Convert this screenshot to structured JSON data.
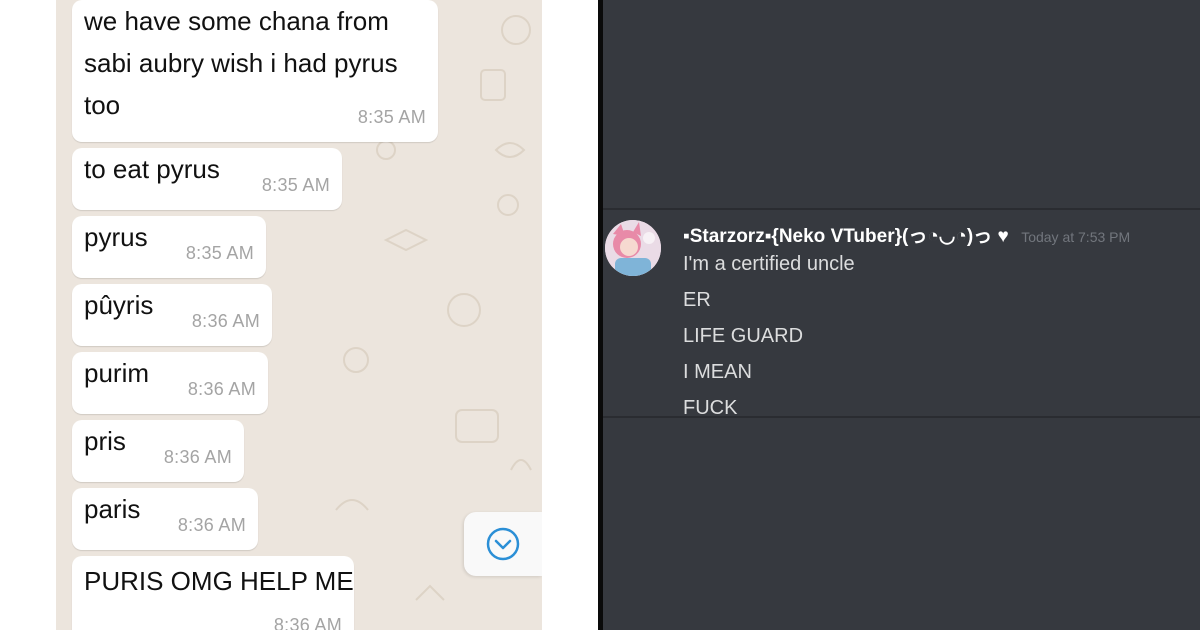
{
  "whatsapp": {
    "messages": [
      {
        "lines": [
          "we have some chana from",
          "sabi aubry wish i had pyrus",
          "too"
        ],
        "time": "8:35 AM"
      },
      {
        "lines": [
          "to eat pyrus"
        ],
        "time": "8:35 AM"
      },
      {
        "lines": [
          "pyrus"
        ],
        "time": "8:35 AM"
      },
      {
        "lines": [
          "pûyris"
        ],
        "time": "8:36 AM"
      },
      {
        "lines": [
          "purim"
        ],
        "time": "8:36 AM"
      },
      {
        "lines": [
          "pris"
        ],
        "time": "8:36 AM"
      },
      {
        "lines": [
          "paris"
        ],
        "time": "8:36 AM"
      },
      {
        "lines": [
          "PURIS OMG HELP ME"
        ],
        "time": "8:36 AM"
      }
    ],
    "scroll_button_icon": "chevron-down-circle-icon",
    "colors": {
      "background": "#ece5dd",
      "bubble": "#ffffff",
      "accent": "#2b8fd6"
    }
  },
  "discord": {
    "avatar_icon": "anime-avatar",
    "username": "▪Starzorz▪{Neko VTuber}(っ◔◡◔)っ ♥",
    "timestamp": "Today at 7:53 PM",
    "messages": [
      "I'm a certified uncle",
      "ER",
      "LIFE GUARD",
      "I MEAN",
      "FUCK"
    ],
    "colors": {
      "background": "#36393f",
      "username": "#ffffff",
      "text": "#dcddde",
      "timestamp": "#72767d"
    }
  }
}
